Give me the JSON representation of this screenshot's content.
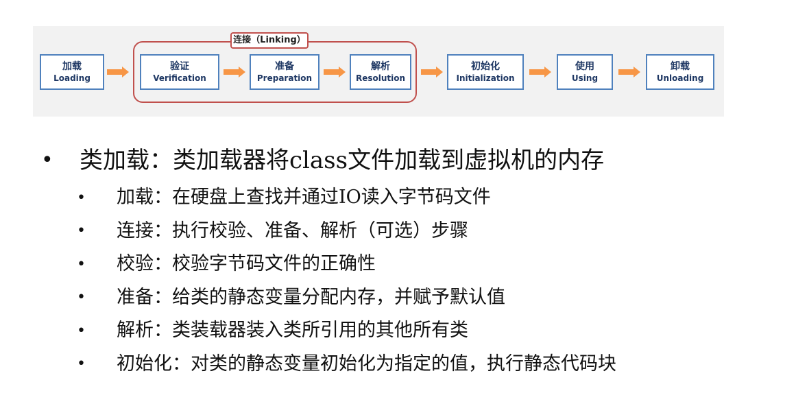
{
  "diagram": {
    "linking_label": "连接（Linking）",
    "stages": [
      {
        "cn": "加载",
        "en": "Loading"
      },
      {
        "cn": "验证",
        "en": "Verification"
      },
      {
        "cn": "准备",
        "en": "Preparation"
      },
      {
        "cn": "解析",
        "en": "Resolution"
      },
      {
        "cn": "初始化",
        "en": "Initialization"
      },
      {
        "cn": "使用",
        "en": "Using"
      },
      {
        "cn": "卸载",
        "en": "Unloading"
      }
    ],
    "colors": {
      "box_border": "#4f81bd",
      "arrow": "#f79646",
      "linking_border": "#c0504d"
    }
  },
  "bullets": {
    "main": "类加载：类加载器将class文件加载到虚拟机的内存",
    "items": [
      "加载：在硬盘上查找并通过IO读入字节码文件",
      "连接：执行校验、准备、解析（可选）步骤",
      "校验：校验字节码文件的正确性",
      "准备：给类的静态变量分配内存，并赋予默认值",
      "解析：类装载器装入类所引用的其他所有类",
      "初始化：对类的静态变量初始化为指定的值，执行静态代码块"
    ]
  }
}
